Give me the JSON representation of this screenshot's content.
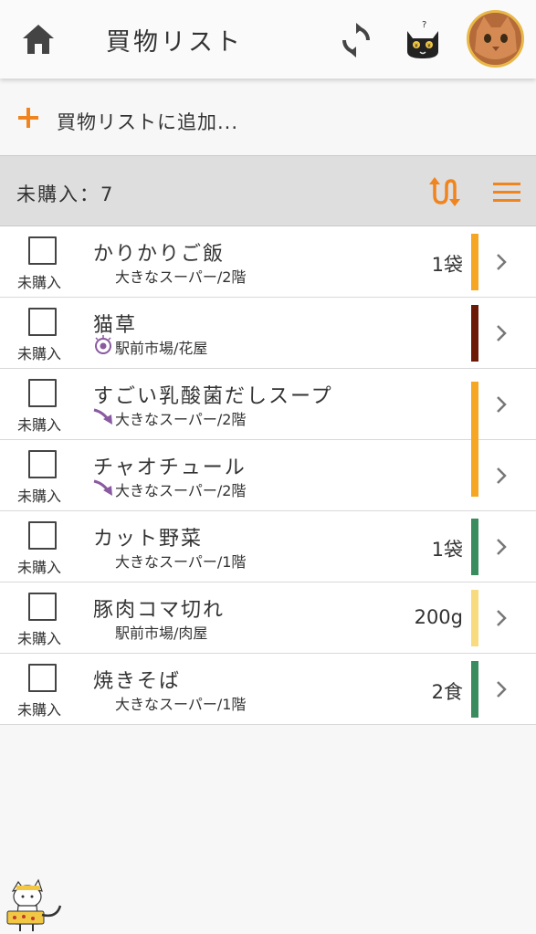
{
  "header": {
    "title": "買物リスト",
    "home_icon": "home-icon",
    "sync_icon": "sync-icon",
    "cat_icon": "cat-face-icon",
    "avatar_icon": "cat-avatar"
  },
  "add": {
    "label": "買物リストに追加..."
  },
  "section": {
    "label": "未購入：7"
  },
  "colors": {
    "accent": "#f0841e",
    "purple": "#8a5aa0"
  },
  "items": [
    {
      "name": "かりかりご飯",
      "store": "大きなスーパー/2階",
      "qty": "1袋",
      "status": "未購入",
      "bar_color": "#f5a623",
      "icon": ""
    },
    {
      "name": "猫草",
      "store": "駅前市場/花屋",
      "qty": "",
      "status": "未購入",
      "bar_color": "#6b1a08",
      "icon": "target-icon"
    },
    {
      "name": "すごい乳酸菌だしスープ",
      "store": "大きなスーパー/2階",
      "qty": "",
      "status": "未購入",
      "bar_color": "#f5a623",
      "icon": "curved-arrow-icon"
    },
    {
      "name": "チャオチュール",
      "store": "大きなスーパー/2階",
      "qty": "",
      "status": "未購入",
      "bar_color": "#f5a623",
      "icon": "curved-arrow-icon"
    },
    {
      "name": "カット野菜",
      "store": "大きなスーパー/1階",
      "qty": "1袋",
      "status": "未購入",
      "bar_color": "#3a8c5e",
      "icon": ""
    },
    {
      "name": "豚肉コマ切れ",
      "store": "駅前市場/肉屋",
      "qty": "200g",
      "status": "未購入",
      "bar_color": "#f7db7e",
      "icon": ""
    },
    {
      "name": "焼きそば",
      "store": "大きなスーパー/1階",
      "qty": "2食",
      "status": "未購入",
      "bar_color": "#3a8c5e",
      "icon": ""
    }
  ]
}
